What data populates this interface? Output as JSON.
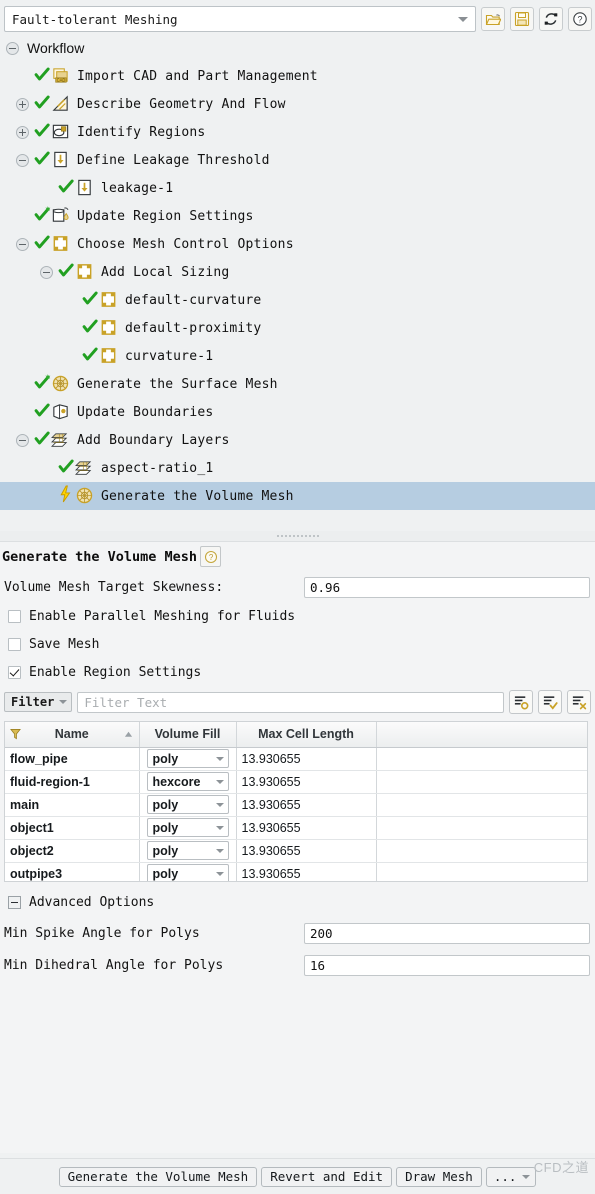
{
  "topbar": {
    "workflow_value": "Fault-tolerant Meshing",
    "buttons": [
      {
        "name": "open-workflow-button",
        "icon": "folder-open-icon"
      },
      {
        "name": "save-workflow-button",
        "icon": "save-icon"
      },
      {
        "name": "reset-workflow-button",
        "icon": "refresh-icon"
      },
      {
        "name": "help-button",
        "icon": "help-icon"
      }
    ]
  },
  "tree": {
    "root_label": "Workflow",
    "nodes": [
      {
        "label": "Import CAD and Part Management",
        "indent": 0,
        "toggle": "none",
        "icon": "cad-icon",
        "state": "done"
      },
      {
        "label": "Describe Geometry And Flow",
        "indent": 0,
        "toggle": "plus",
        "icon": "geometry-icon",
        "state": "done"
      },
      {
        "label": "Identify Regions",
        "indent": 0,
        "toggle": "plus",
        "icon": "regions-icon",
        "state": "done"
      },
      {
        "label": "Define Leakage Threshold",
        "indent": 0,
        "toggle": "minus",
        "icon": "leakage-icon",
        "state": "done"
      },
      {
        "label": "leakage-1",
        "indent": 1,
        "toggle": "none",
        "icon": "leakage-icon",
        "state": "done"
      },
      {
        "label": "Update Region Settings",
        "indent": 0,
        "toggle": "none",
        "icon": "update-region-icon",
        "state": "done-star"
      },
      {
        "label": "Choose Mesh Control Options",
        "indent": 0,
        "toggle": "minus",
        "icon": "sizing-icon",
        "state": "done"
      },
      {
        "label": "Add Local Sizing",
        "indent": 1,
        "toggle": "minus",
        "icon": "sizing-icon",
        "state": "done"
      },
      {
        "label": "default-curvature",
        "indent": 2,
        "toggle": "none",
        "icon": "sizing-icon",
        "state": "done"
      },
      {
        "label": "default-proximity",
        "indent": 2,
        "toggle": "none",
        "icon": "sizing-icon",
        "state": "done"
      },
      {
        "label": "curvature-1",
        "indent": 2,
        "toggle": "none",
        "icon": "sizing-icon",
        "state": "done"
      },
      {
        "label": "Generate the Surface Mesh",
        "indent": 0,
        "toggle": "none",
        "icon": "mesh-globe-icon",
        "state": "done-star"
      },
      {
        "label": "Update Boundaries",
        "indent": 0,
        "toggle": "none",
        "icon": "boundaries-icon",
        "state": "done"
      },
      {
        "label": "Add Boundary Layers",
        "indent": 0,
        "toggle": "minus",
        "icon": "layers-icon",
        "state": "done"
      },
      {
        "label": "aspect-ratio_1",
        "indent": 1,
        "toggle": "none",
        "icon": "layers-icon",
        "state": "done"
      },
      {
        "label": "Generate the Volume Mesh",
        "indent": 1,
        "toggle": "none",
        "icon": "mesh-globe-icon",
        "state": "pending",
        "selected": true
      }
    ]
  },
  "panel": {
    "title": "Generate the Volume Mesh",
    "skewness_label": "Volume Mesh Target Skewness:",
    "skewness_value": "0.96",
    "checkboxes": [
      {
        "label": "Enable Parallel Meshing for Fluids",
        "checked": false,
        "name": "enable-parallel-meshing-checkbox"
      },
      {
        "label": "Save Mesh",
        "checked": false,
        "name": "save-mesh-checkbox"
      },
      {
        "label": "Enable Region Settings",
        "checked": true,
        "name": "enable-region-settings-checkbox"
      }
    ],
    "filter": {
      "button_label": "Filter",
      "placeholder": "Filter Text",
      "icons": [
        {
          "name": "select-by-list-icon"
        },
        {
          "name": "check-all-icon"
        },
        {
          "name": "uncheck-all-icon"
        }
      ]
    },
    "table": {
      "columns": [
        "Name",
        "Volume Fill",
        "Max Cell Length"
      ],
      "sort_column": "Name",
      "sort_direction": "ascending",
      "rows": [
        {
          "name": "flow_pipe",
          "volume_fill": "poly",
          "max_cell_length": "13.930655"
        },
        {
          "name": "fluid-region-1",
          "volume_fill": "hexcore",
          "max_cell_length": "13.930655"
        },
        {
          "name": "main",
          "volume_fill": "poly",
          "max_cell_length": "13.930655"
        },
        {
          "name": "object1",
          "volume_fill": "poly",
          "max_cell_length": "13.930655"
        },
        {
          "name": "object2",
          "volume_fill": "poly",
          "max_cell_length": "13.930655"
        },
        {
          "name": "outpipe3",
          "volume_fill": "poly",
          "max_cell_length": "13.930655"
        }
      ]
    },
    "advanced": {
      "header": "Advanced Options",
      "fields": [
        {
          "label": "Min Spike Angle for Polys",
          "value": "200",
          "name": "min-spike-angle-field"
        },
        {
          "label": "Min Dihedral Angle for Polys",
          "value": "16",
          "name": "min-dihedral-angle-field"
        }
      ]
    }
  },
  "bottom": {
    "buttons": [
      {
        "label": "Generate the Volume Mesh",
        "name": "generate-volume-mesh-button"
      },
      {
        "label": "Revert and Edit",
        "name": "revert-and-edit-button"
      },
      {
        "label": "Draw Mesh",
        "name": "draw-mesh-button"
      },
      {
        "label": "...",
        "name": "more-options-button"
      }
    ],
    "watermark": "CFD之道"
  }
}
